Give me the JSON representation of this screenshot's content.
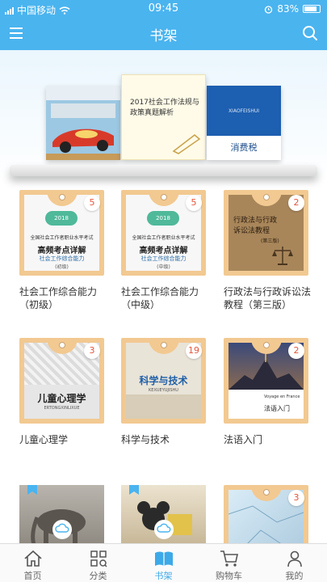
{
  "status": {
    "carrier": "中国移动",
    "time": "09:45",
    "battery": "83%"
  },
  "header": {
    "title": "书架"
  },
  "shelf": {
    "book1_title": "2017社会工作法规与政策真题解析",
    "book2_top": "XIAOFEISHUI",
    "book2_title": "消费税"
  },
  "books": [
    {
      "title": "社会工作综合能力（初级）",
      "count": "5",
      "cover_title": "全国社会工作者职业水平考试",
      "cover_big": "高频考点详解",
      "cover_sub": "社会工作综合能力",
      "cover_level": "(初级)",
      "cover_year": "2018"
    },
    {
      "title": "社会工作综合能力（中级）",
      "count": "5",
      "cover_title": "全国社会工作者职业水平考试",
      "cover_big": "高频考点详解",
      "cover_sub": "社会工作综合能力",
      "cover_level": "(中级)",
      "cover_year": "2018"
    },
    {
      "title": "行政法与行政诉讼法教程（第三版）",
      "count": "2",
      "cover_title": "行政法与行政诉讼法教程",
      "cover_sub": "(第三版)"
    },
    {
      "title": "儿童心理学",
      "count": "3",
      "cover_title": "儿童心理学",
      "cover_sub": "ERTONGXINLIXUE"
    },
    {
      "title": "科学与技术",
      "count": "19",
      "cover_title": "科学与技术",
      "cover_sub": "KEXUEYUJISHU"
    },
    {
      "title": "法语入门",
      "count": "2",
      "cover_sub": "Voyage en France",
      "cover_title": "法语入门"
    },
    {
      "title": "",
      "count": ""
    },
    {
      "title": "",
      "count": ""
    },
    {
      "title": "",
      "count": "3"
    }
  ],
  "tabs": [
    {
      "label": "首页",
      "icon": "home-icon"
    },
    {
      "label": "分类",
      "icon": "category-icon"
    },
    {
      "label": "书架",
      "icon": "book-icon"
    },
    {
      "label": "购物车",
      "icon": "cart-icon"
    },
    {
      "label": "我的",
      "icon": "user-icon"
    }
  ],
  "colors": {
    "accent": "#4ab4ef",
    "card": "#f2c991",
    "badge_text": "#e4573d",
    "tab_active": "#3da9e8"
  }
}
